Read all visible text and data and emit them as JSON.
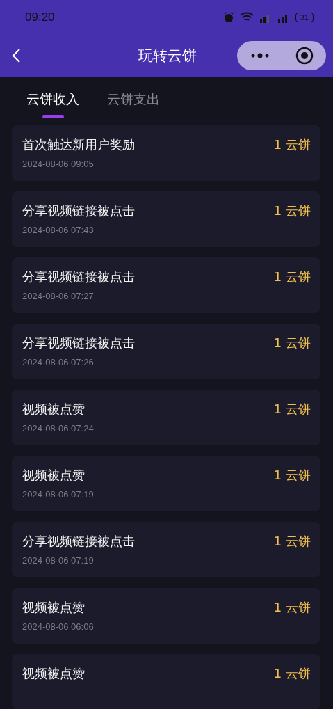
{
  "status_bar": {
    "time": "09:20",
    "battery": "31"
  },
  "header": {
    "title": "玩转云饼"
  },
  "tabs": [
    {
      "label": "云饼收入",
      "selected": true
    },
    {
      "label": "云饼支出",
      "selected": false
    }
  ],
  "records": [
    {
      "title": "首次触达新用户奖励",
      "time": "2024-08-06 09:05",
      "amount": "1 云饼"
    },
    {
      "title": "分享视频链接被点击",
      "time": "2024-08-06 07:43",
      "amount": "1 云饼"
    },
    {
      "title": "分享视频链接被点击",
      "time": "2024-08-06 07:27",
      "amount": "1 云饼"
    },
    {
      "title": "分享视频链接被点击",
      "time": "2024-08-06 07:26",
      "amount": "1 云饼"
    },
    {
      "title": "视频被点赞",
      "time": "2024-08-06 07:24",
      "amount": "1 云饼"
    },
    {
      "title": "视频被点赞",
      "time": "2024-08-06 07:19",
      "amount": "1 云饼"
    },
    {
      "title": "分享视频链接被点击",
      "time": "2024-08-06 07:19",
      "amount": "1 云饼"
    },
    {
      "title": "视频被点赞",
      "time": "2024-08-06 06:06",
      "amount": "1 云饼"
    },
    {
      "title": "视频被点赞",
      "amount": "1 云饼"
    }
  ]
}
